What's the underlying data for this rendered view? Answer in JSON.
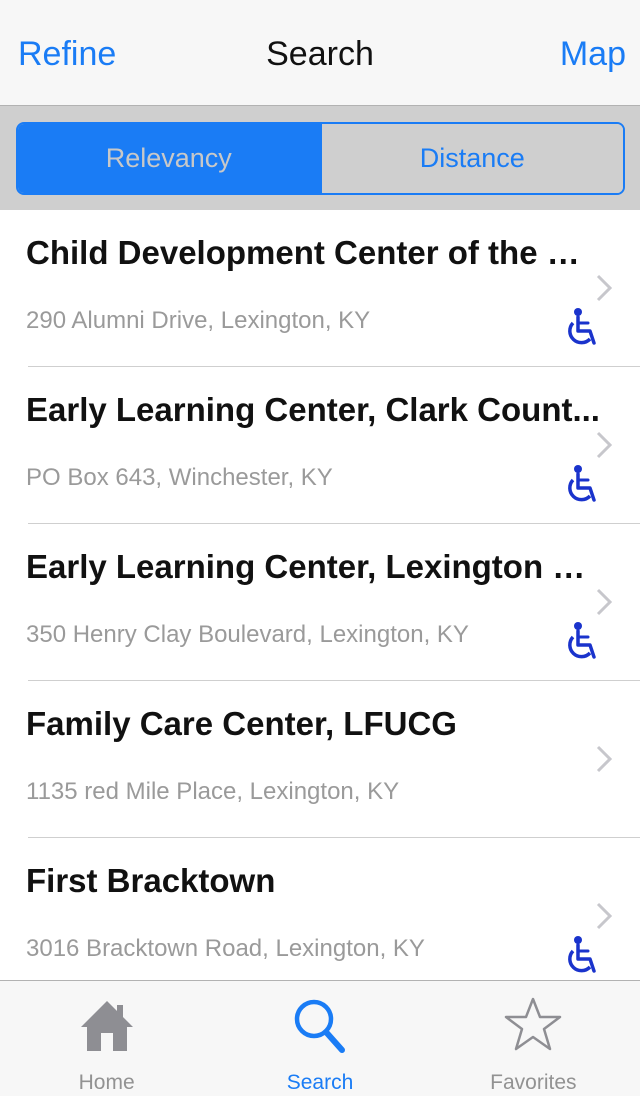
{
  "navbar": {
    "left_label": "Refine",
    "title": "Search",
    "right_label": "Map"
  },
  "segmented": {
    "items": [
      {
        "label": "Relevancy",
        "selected": true
      },
      {
        "label": "Distance",
        "selected": false
      }
    ]
  },
  "results": [
    {
      "title": "Child Development Center of the Bl...",
      "address": "290 Alumni Drive, Lexington, KY",
      "accessible": true
    },
    {
      "title": "Early Learning Center, Clark Count...",
      "address": "PO Box 643, Winchester, KY",
      "accessible": true
    },
    {
      "title": "Early Learning Center, Lexington H...",
      "address": "350 Henry Clay Boulevard, Lexington, KY",
      "accessible": true
    },
    {
      "title": "Family Care Center, LFUCG",
      "address": "1135 red Mile Place, Lexington, KY",
      "accessible": false
    },
    {
      "title": "First Bracktown",
      "address": "3016 Bracktown Road, Lexington, KY",
      "accessible": true
    }
  ],
  "tabbar": {
    "items": [
      {
        "label": "Home",
        "icon": "home-icon",
        "active": false
      },
      {
        "label": "Search",
        "icon": "search-icon",
        "active": true
      },
      {
        "label": "Favorites",
        "icon": "star-icon",
        "active": false
      }
    ]
  },
  "colors": {
    "accent": "#1a7cf5",
    "accessibility_icon": "#1a33cc",
    "secondary_text": "#9a9a9a"
  }
}
